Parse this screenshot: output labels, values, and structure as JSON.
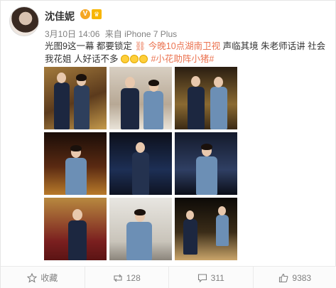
{
  "user": {
    "name": "沈佳妮",
    "badge_v": "V",
    "badge_crown": "♛"
  },
  "meta": {
    "date": "3月10日 14:06",
    "source": "来自 iPhone 7 Plus"
  },
  "post": {
    "text_part1": "光图9这一幕 都要锁定",
    "link_text": "今晚10点湖南卫视",
    "text_part2": "声临其境 朱老师话讲 社会我花姐 人好话不多",
    "hashtag": "#小花助阵小猪#"
  },
  "images": [
    {
      "label": "photo-1"
    },
    {
      "label": "photo-2"
    },
    {
      "label": "photo-3"
    },
    {
      "label": "photo-4"
    },
    {
      "label": "photo-5"
    },
    {
      "label": "photo-6"
    },
    {
      "label": "photo-7"
    },
    {
      "label": "photo-8"
    },
    {
      "label": "photo-9"
    }
  ],
  "footer": {
    "favorite_label": "收藏",
    "repost_count": "128",
    "comment_count": "311",
    "like_count": "9383"
  },
  "colors": {
    "highlight": "#eb7350",
    "meta_gray": "#808080"
  }
}
